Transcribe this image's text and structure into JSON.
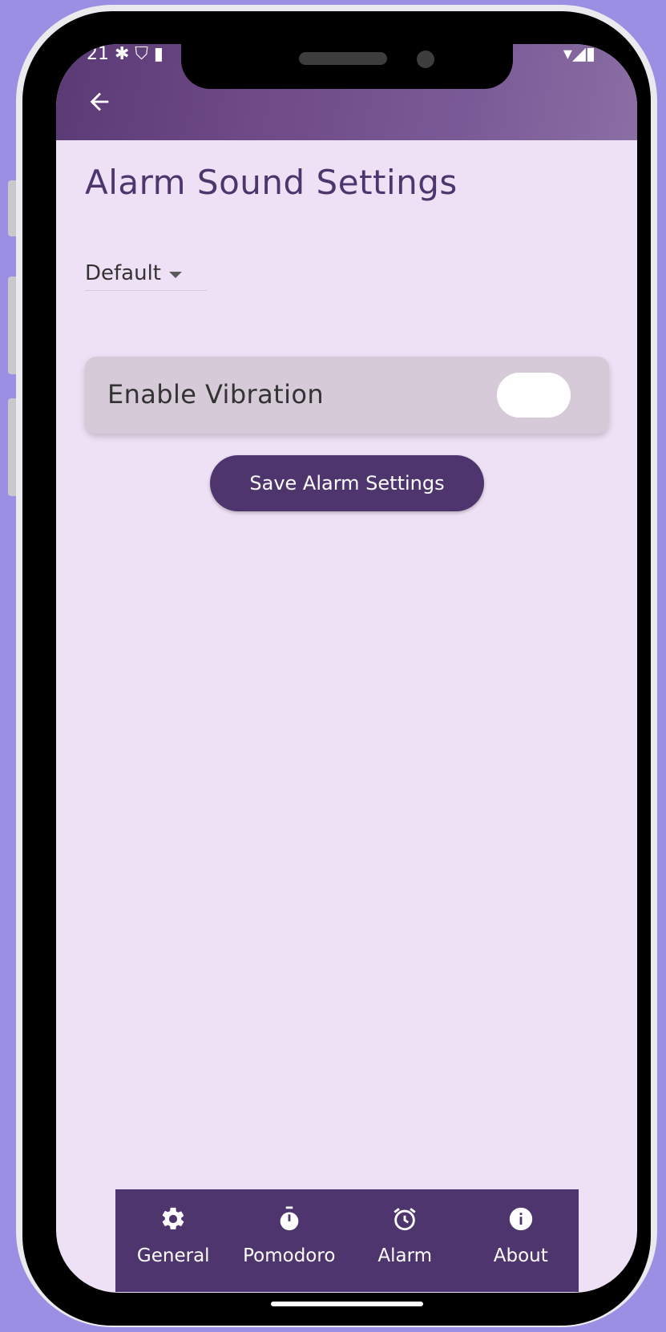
{
  "status_bar": {
    "left": "21 ✱ ⛉ ▮",
    "right": "▾◢▮"
  },
  "app_bar": {
    "back_icon": "arrow-left-icon"
  },
  "page": {
    "title": "Alarm Sound Settings"
  },
  "sound_dropdown": {
    "value": "Default"
  },
  "vibration": {
    "label": "Enable Vibration",
    "enabled": false
  },
  "save_button": {
    "label": "Save Alarm Settings"
  },
  "bottom_nav": {
    "items": [
      {
        "label": "General",
        "icon": "gear-icon"
      },
      {
        "label": "Pomodoro",
        "icon": "stopwatch-icon"
      },
      {
        "label": "Alarm",
        "icon": "alarm-clock-icon"
      },
      {
        "label": "About",
        "icon": "info-icon"
      }
    ]
  },
  "colors": {
    "background": "#9b8fe3",
    "screen": "#efe1f5",
    "primary": "#4e356e",
    "card": "#d6cad9"
  }
}
